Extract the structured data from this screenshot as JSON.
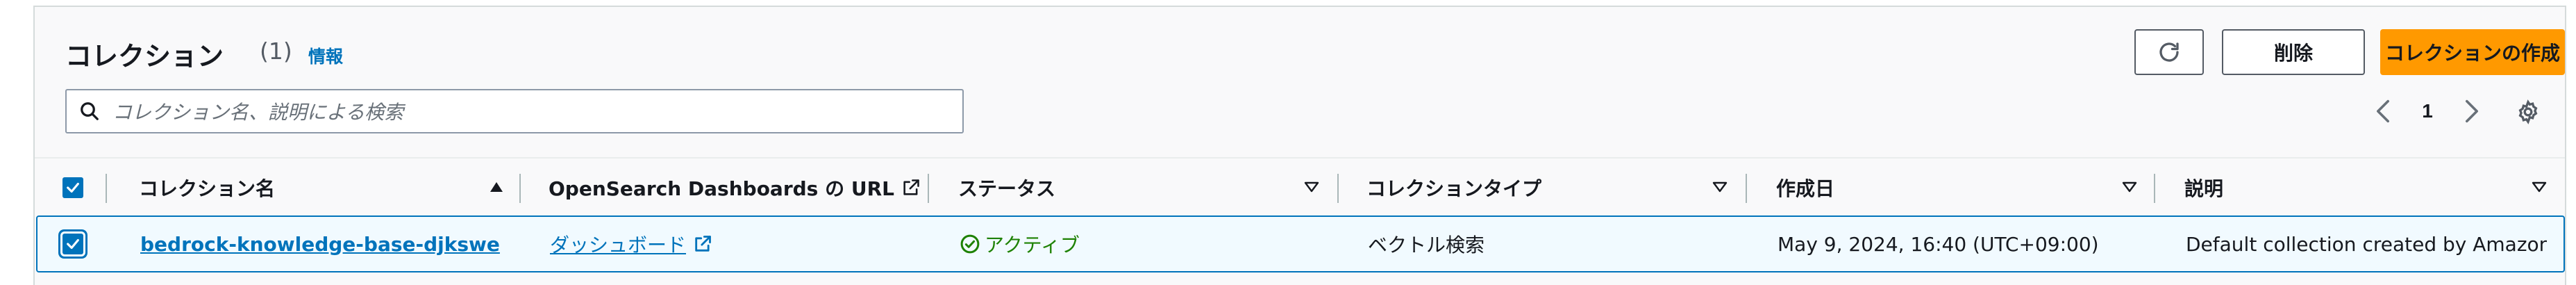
{
  "header": {
    "title": "コレクション",
    "count": "(1)",
    "info_link": "情報"
  },
  "toolbar": {
    "refresh_icon": "refresh-icon",
    "delete_label": "削除",
    "create_label": "コレクションの作成"
  },
  "search": {
    "placeholder": "コレクション名、説明による検索",
    "icon": "search-icon"
  },
  "pagination": {
    "current_page": "1",
    "prev_icon": "chevron-left-icon",
    "next_icon": "chevron-right-icon",
    "settings_icon": "gear-icon"
  },
  "table": {
    "columns": [
      {
        "label": "コレクション名",
        "sort": "ascending"
      },
      {
        "label": "OpenSearch Dashboards の URL",
        "sort": "none"
      },
      {
        "label": "ステータス",
        "sort": "sortable"
      },
      {
        "label": "コレクションタイプ",
        "sort": "sortable"
      },
      {
        "label": "作成日",
        "sort": "sortable"
      },
      {
        "label": "説明",
        "sort": "sortable"
      }
    ],
    "rows": [
      {
        "selected": true,
        "name": "bedrock-knowledge-base-djkswe",
        "dashboard_link": "ダッシュボード",
        "status": "アクティブ",
        "type": "ベクトル検索",
        "created": "May 9, 2024, 16:40 (UTC+09:00)",
        "description": "Default collection created by Amazon..."
      }
    ]
  },
  "colors": {
    "accent": "#0073bb",
    "primary_button": "#ff9900",
    "status_active": "#1d8102",
    "selected_row_bg": "#f1faff"
  }
}
